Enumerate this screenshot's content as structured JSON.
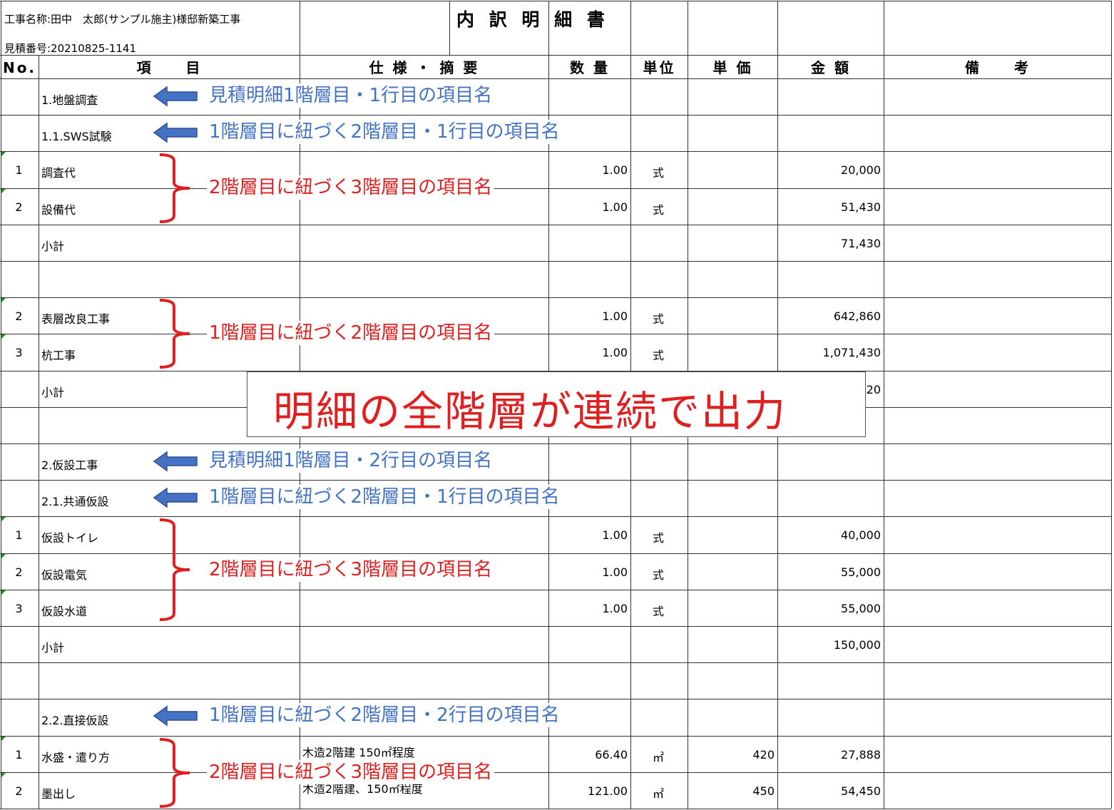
{
  "header": {
    "project_name": "工事名称:田中　太郎(サンプル施主)様邸新築工事",
    "estimate_number": "見積番号:20210825-1141",
    "title": "内 訳 明 細 書"
  },
  "columns": [
    "No.",
    "項　　目",
    "仕 様 ・ 摘 要",
    "数 量",
    "単位",
    "単 価",
    "金 額",
    "備　　考"
  ],
  "rows": [
    {
      "no": "",
      "item": "1.地盤調査",
      "spec": "",
      "qty": "",
      "unit": "",
      "price": "",
      "amount": "",
      "note": ""
    },
    {
      "no": "",
      "item": "1.1.SWS試験",
      "spec": "",
      "qty": "",
      "unit": "",
      "price": "",
      "amount": "",
      "note": ""
    },
    {
      "no": "1",
      "item": "調査代",
      "spec": "",
      "qty": "1.00",
      "unit": "式",
      "price": "",
      "amount": "20,000",
      "note": ""
    },
    {
      "no": "2",
      "item": "設備代",
      "spec": "",
      "qty": "1.00",
      "unit": "式",
      "price": "",
      "amount": "51,430",
      "note": ""
    },
    {
      "no": "",
      "item": "小計",
      "spec": "",
      "qty": "",
      "unit": "",
      "price": "",
      "amount": "71,430",
      "note": ""
    },
    {
      "no": "",
      "item": "",
      "spec": "",
      "qty": "",
      "unit": "",
      "price": "",
      "amount": "",
      "note": ""
    },
    {
      "no": "2",
      "item": "表層改良工事",
      "spec": "",
      "qty": "1.00",
      "unit": "式",
      "price": "",
      "amount": "642,860",
      "note": ""
    },
    {
      "no": "3",
      "item": "杭工事",
      "spec": "",
      "qty": "1.00",
      "unit": "式",
      "price": "",
      "amount": "1,071,430",
      "note": ""
    },
    {
      "no": "",
      "item": "小計",
      "spec": "",
      "qty": "",
      "unit": "",
      "price": "",
      "amount": "20",
      "note": ""
    },
    {
      "no": "",
      "item": "",
      "spec": "",
      "qty": "",
      "unit": "",
      "price": "",
      "amount": "",
      "note": ""
    },
    {
      "no": "",
      "item": "2.仮設工事",
      "spec": "",
      "qty": "",
      "unit": "",
      "price": "",
      "amount": "",
      "note": ""
    },
    {
      "no": "",
      "item": "2.1.共通仮設",
      "spec": "",
      "qty": "",
      "unit": "",
      "price": "",
      "amount": "",
      "note": ""
    },
    {
      "no": "1",
      "item": "仮設トイレ",
      "spec": "",
      "qty": "1.00",
      "unit": "式",
      "price": "",
      "amount": "40,000",
      "note": ""
    },
    {
      "no": "2",
      "item": "仮設電気",
      "spec": "",
      "qty": "1.00",
      "unit": "式",
      "price": "",
      "amount": "55,000",
      "note": ""
    },
    {
      "no": "3",
      "item": "仮設水道",
      "spec": "",
      "qty": "1.00",
      "unit": "式",
      "price": "",
      "amount": "55,000",
      "note": ""
    },
    {
      "no": "",
      "item": "小計",
      "spec": "",
      "qty": "",
      "unit": "",
      "price": "",
      "amount": "150,000",
      "note": ""
    },
    {
      "no": "",
      "item": "",
      "spec": "",
      "qty": "",
      "unit": "",
      "price": "",
      "amount": "",
      "note": ""
    },
    {
      "no": "",
      "item": "2.2.直接仮設",
      "spec": "",
      "qty": "",
      "unit": "",
      "price": "",
      "amount": "",
      "note": ""
    },
    {
      "no": "1",
      "item": "水盛・遣り方",
      "spec": "木造2階建 150㎡程度",
      "qty": "66.40",
      "unit": "㎡",
      "price": "420",
      "amount": "27,888",
      "note": ""
    },
    {
      "no": "2",
      "item": "墨出し",
      "spec": "木造2階建、150㎡程度",
      "qty": "121.00",
      "unit": "㎡",
      "price": "450",
      "amount": "54,450",
      "note": ""
    }
  ],
  "annotations": {
    "a1": "見積明細1階層目・1行目の項目名",
    "a2": "1階層目に紐づく2階層目・1行目の項目名",
    "a3": "2階層目に紐づく3階層目の項目名",
    "a4": "1階層目に紐づく2階層目の項目名",
    "a5": "見積明細1階層目・2行目の項目名",
    "a6": "1階層目に紐づく2階層目・1行目の項目名",
    "a7": "2階層目に紐づく3階層目の項目名",
    "a8": "1階層目に紐づく2階層目・2行目の項目名",
    "a9": "2階層目に紐づく3階層目の項目名"
  },
  "callout": "明細の全階層が連続で出力",
  "colors": {
    "blue_annotation": "#4472c4",
    "red_annotation": "#e02020",
    "cell_marker": "#1a8a1a"
  }
}
